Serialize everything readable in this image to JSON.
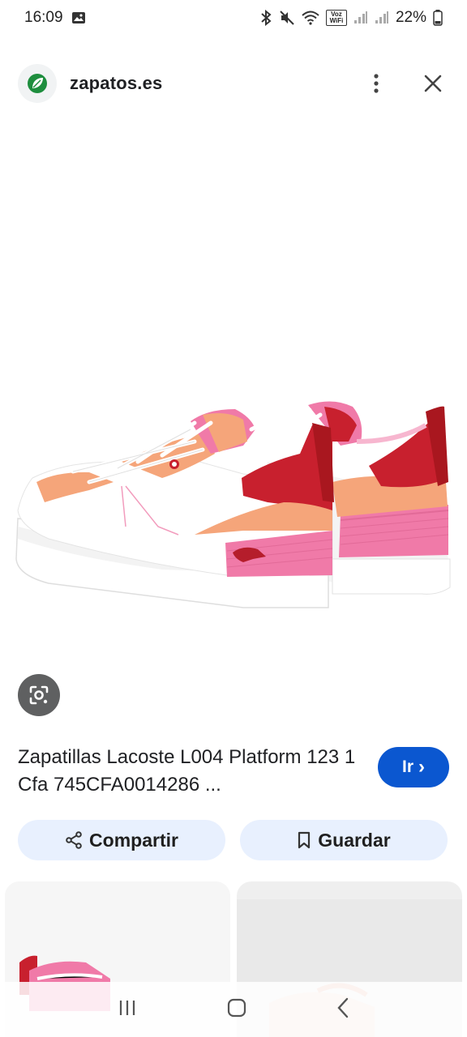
{
  "status_bar": {
    "time": "16:09",
    "battery": "22%",
    "wifi_label": "Voz WiFi",
    "icons": [
      "image-icon",
      "bluetooth-icon",
      "mute-icon",
      "wifi-icon",
      "signal-icon",
      "battery-icon"
    ]
  },
  "header": {
    "site": "zapatos.es",
    "favicon_color": "#1e8e3e"
  },
  "product": {
    "title": "Zapatillas Lacoste L004 Platform 123 1 Cfa 745CFA0014286 ...",
    "go_label": "Ir",
    "go_chevron": "›",
    "go_color": "#0b57d0"
  },
  "actions": {
    "share_label": "Compartir",
    "save_label": "Guardar"
  },
  "colors": {
    "pill_bg": "#e8f0fe",
    "shoe_pink": "#f07aa8",
    "shoe_peach": "#f5a57a",
    "shoe_red": "#c8202e"
  }
}
